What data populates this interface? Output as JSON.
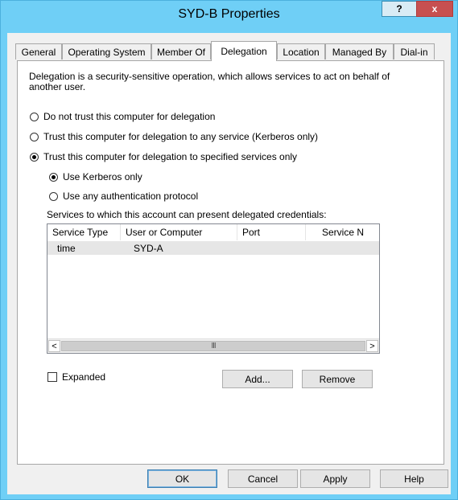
{
  "window": {
    "title": "SYD-B Properties",
    "help_label": "?",
    "close_label": "x"
  },
  "tabs": [
    {
      "label": "General"
    },
    {
      "label": "Operating System"
    },
    {
      "label": "Member Of"
    },
    {
      "label": "Delegation"
    },
    {
      "label": "Location"
    },
    {
      "label": "Managed By"
    },
    {
      "label": "Dial-in"
    }
  ],
  "delegation": {
    "description": "Delegation is a security-sensitive operation, which allows services to act on behalf of another user.",
    "options": [
      {
        "label": "Do not trust this computer for delegation",
        "checked": false
      },
      {
        "label": "Trust this computer for delegation to any service (Kerberos only)",
        "checked": false
      },
      {
        "label": "Trust this computer for delegation to specified services only",
        "checked": true
      }
    ],
    "sub_options": [
      {
        "label": "Use Kerberos only",
        "checked": true
      },
      {
        "label": "Use any authentication protocol",
        "checked": false
      }
    ],
    "services_label": "Services to which this account can present delegated credentials:",
    "columns": [
      "Service Type",
      "User or Computer",
      "Port",
      "Service N"
    ],
    "rows": [
      {
        "service_type": "time",
        "user_or_computer": "SYD-A",
        "port": "",
        "service_name": ""
      }
    ],
    "scroll_left_label": "<",
    "scroll_right_label": ">",
    "scroll_grip_label": "III",
    "expanded_label": "Expanded",
    "expanded_checked": false,
    "add_label": "Add...",
    "remove_label": "Remove"
  },
  "footer": {
    "ok_label": "OK",
    "cancel_label": "Cancel",
    "apply_label": "Apply",
    "help_label": "Help"
  }
}
